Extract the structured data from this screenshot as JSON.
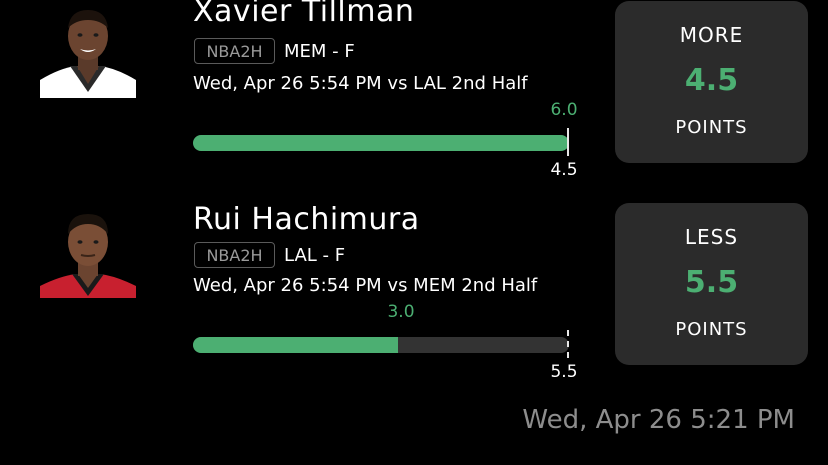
{
  "picks": [
    {
      "player": "Xavier Tillman",
      "league": "NBA2H",
      "team_position": "MEM - F",
      "game": "Wed, Apr 26 5:54 PM  vs LAL 2nd Half",
      "current": 6.0,
      "current_label": "6.0",
      "line": 4.5,
      "line_label": "4.5",
      "progress_fraction": 1.0,
      "marker_fraction": 1.0,
      "choice": "MORE",
      "choice_line": "4.5",
      "stat": "POINTS",
      "jersey_color": "#ffffff",
      "jersey_trim": "#2a2a2a"
    },
    {
      "player": "Rui Hachimura",
      "league": "NBA2H",
      "team_position": "LAL - F",
      "game": "Wed, Apr 26 5:54 PM  vs MEM 2nd Half",
      "current": 3.0,
      "current_label": "3.0",
      "line": 5.5,
      "line_label": "5.5",
      "progress_fraction": 0.545,
      "marker_fraction": 1.0,
      "choice": "LESS",
      "choice_line": "5.5",
      "stat": "POINTS",
      "jersey_color": "#c8202f",
      "jersey_trim": "#1a1a1a"
    }
  ],
  "timestamp": "Wed, Apr 26 5:21 PM",
  "colors": {
    "accent": "#4caf72",
    "card": "#2b2b2b",
    "track": "#333333",
    "muted": "#8d8d8d"
  },
  "icons": {
    "headshot": "player-headshot"
  }
}
